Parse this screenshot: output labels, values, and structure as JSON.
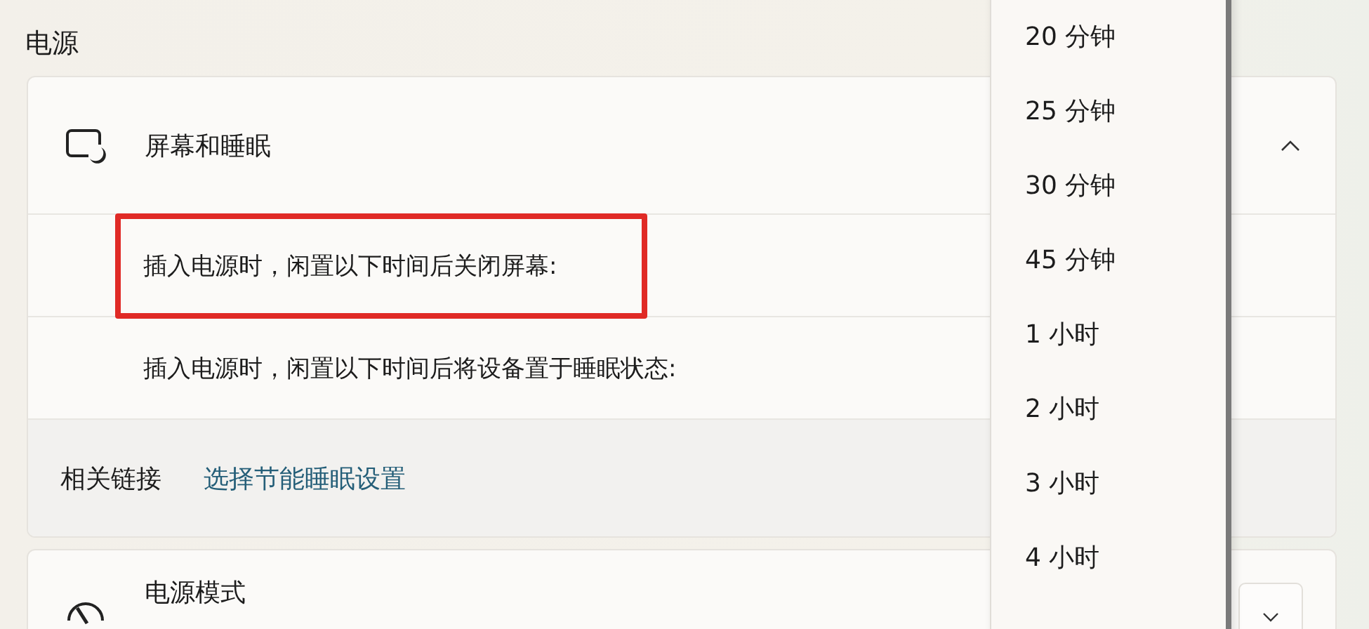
{
  "section_title": "电源",
  "screen_sleep": {
    "title": "屏幕和睡眠",
    "expanded": true,
    "rows": [
      {
        "label": "插入电源时，闲置以下时间后关闭屏幕:",
        "highlighted": true
      },
      {
        "label": "插入电源时，闲置以下时间后将设备置于睡眠状态:",
        "highlighted": false
      }
    ]
  },
  "related_links": {
    "label": "相关链接",
    "link": "选择节能睡眠设置"
  },
  "power_mode": {
    "title": "电源模式"
  },
  "dropdown_options": [
    "20 分钟",
    "25 分钟",
    "30 分钟",
    "45 分钟",
    "1 小时",
    "2 小时",
    "3 小时",
    "4 小时"
  ]
}
